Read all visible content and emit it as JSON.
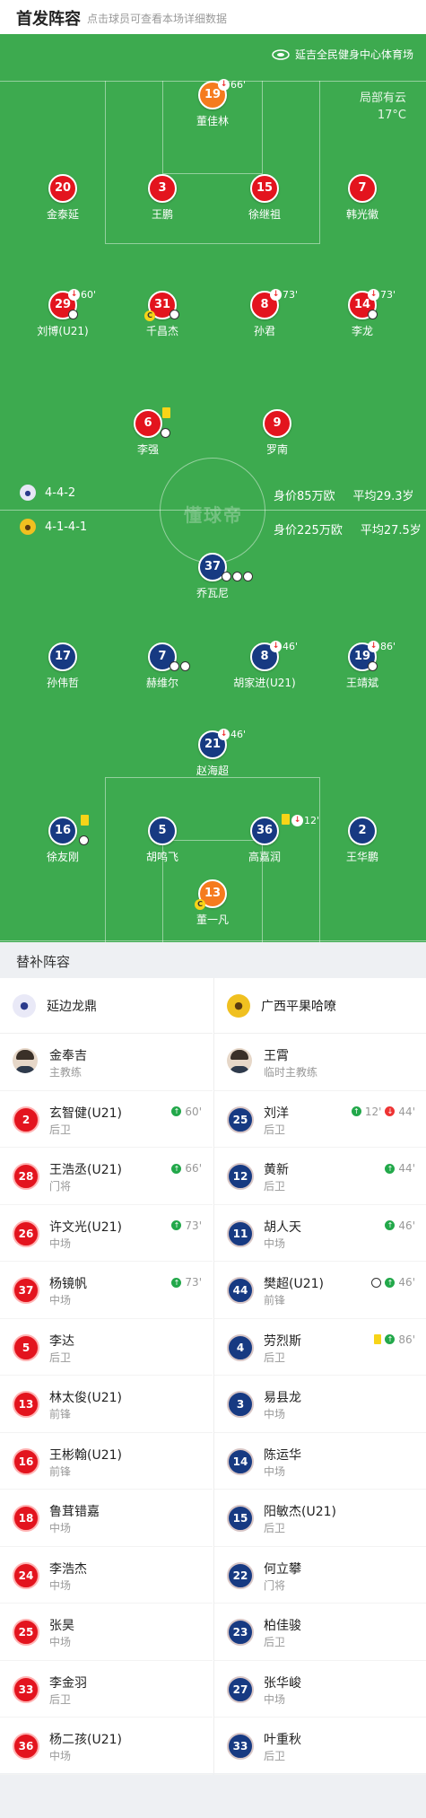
{
  "header": {
    "title": "首发阵容",
    "subtitle": "点击球员可查看本场详细数据"
  },
  "venue": "延吉全民健身中心体育场",
  "weather": {
    "condition": "局部有云",
    "temp": "17°C"
  },
  "watermark": "懂球帝",
  "home_team": {
    "formation": "4-4-2",
    "value": "身价85万欧",
    "avg_age": "平均29.3岁"
  },
  "away_team": {
    "formation": "4-1-4-1",
    "value": "身价225万欧",
    "avg_age": "平均27.5岁"
  },
  "home_players": [
    {
      "num": "19",
      "name": "董佳林",
      "sub": "66'"
    },
    {
      "num": "20",
      "name": "金泰延"
    },
    {
      "num": "3",
      "name": "王鹏"
    },
    {
      "num": "15",
      "name": "徐继祖"
    },
    {
      "num": "7",
      "name": "韩光徽"
    },
    {
      "num": "29",
      "name": "刘博(U21)",
      "sub": "60'"
    },
    {
      "num": "31",
      "name": "千昌杰"
    },
    {
      "num": "8",
      "name": "孙君",
      "sub": "73'"
    },
    {
      "num": "14",
      "name": "李龙",
      "sub": "73'"
    },
    {
      "num": "6",
      "name": "李强"
    },
    {
      "num": "9",
      "name": "罗南"
    }
  ],
  "away_players": [
    {
      "num": "37",
      "name": "乔瓦尼"
    },
    {
      "num": "17",
      "name": "孙伟哲"
    },
    {
      "num": "7",
      "name": "赫维尔"
    },
    {
      "num": "8",
      "name": "胡家进(U21)",
      "sub": "46'"
    },
    {
      "num": "19",
      "name": "王靖斌",
      "sub": "86'"
    },
    {
      "num": "21",
      "name": "赵海超",
      "sub": "46'"
    },
    {
      "num": "16",
      "name": "徐友刚"
    },
    {
      "num": "5",
      "name": "胡鸣飞"
    },
    {
      "num": "36",
      "name": "高嘉润",
      "sub": "12'"
    },
    {
      "num": "2",
      "name": "王华鹏"
    },
    {
      "num": "13",
      "name": "董一凡"
    }
  ],
  "subs_title": "替补阵容",
  "home_bench": {
    "team": "延边龙鼎",
    "coach": {
      "name": "金奉吉",
      "role": "主教练"
    },
    "players": [
      {
        "num": "2",
        "name": "玄智健(U21)",
        "pos": "后卫",
        "ev": "60'"
      },
      {
        "num": "28",
        "name": "王浩丞(U21)",
        "pos": "门将",
        "ev": "66'"
      },
      {
        "num": "26",
        "name": "许文光(U21)",
        "pos": "中场",
        "ev": "73'"
      },
      {
        "num": "37",
        "name": "杨镜帆",
        "pos": "中场",
        "ev": "73'"
      },
      {
        "num": "5",
        "name": "李达",
        "pos": "后卫"
      },
      {
        "num": "13",
        "name": "林太俊(U21)",
        "pos": "前锋"
      },
      {
        "num": "16",
        "name": "王彬翰(U21)",
        "pos": "前锋"
      },
      {
        "num": "18",
        "name": "鲁茸错嘉",
        "pos": "中场"
      },
      {
        "num": "24",
        "name": "李浩杰",
        "pos": "中场"
      },
      {
        "num": "25",
        "name": "张昊",
        "pos": "中场"
      },
      {
        "num": "33",
        "name": "李金羽",
        "pos": "后卫"
      },
      {
        "num": "36",
        "name": "杨二孩(U21)",
        "pos": "中场"
      }
    ]
  },
  "away_bench": {
    "team": "广西平果哈嘹",
    "coach": {
      "name": "王霄",
      "role": "临时主教练"
    },
    "players": [
      {
        "num": "25",
        "name": "刘洋",
        "pos": "后卫",
        "ev": "12'",
        "ev2": "44'"
      },
      {
        "num": "12",
        "name": "黄新",
        "pos": "后卫",
        "ev": "44'"
      },
      {
        "num": "11",
        "name": "胡人天",
        "pos": "中场",
        "ev": "46'"
      },
      {
        "num": "44",
        "name": "樊超(U21)",
        "pos": "前锋",
        "ev": "46'"
      },
      {
        "num": "4",
        "name": "劳烈斯",
        "pos": "后卫",
        "ev": "86'"
      },
      {
        "num": "3",
        "name": "易县龙",
        "pos": "中场"
      },
      {
        "num": "14",
        "name": "陈运华",
        "pos": "中场"
      },
      {
        "num": "15",
        "name": "阳敏杰(U21)",
        "pos": "后卫"
      },
      {
        "num": "22",
        "name": "何立攀",
        "pos": "门将"
      },
      {
        "num": "23",
        "name": "柏佳骏",
        "pos": "后卫"
      },
      {
        "num": "27",
        "name": "张华峻",
        "pos": "中场"
      },
      {
        "num": "33",
        "name": "叶重秋",
        "pos": "后卫"
      }
    ]
  }
}
